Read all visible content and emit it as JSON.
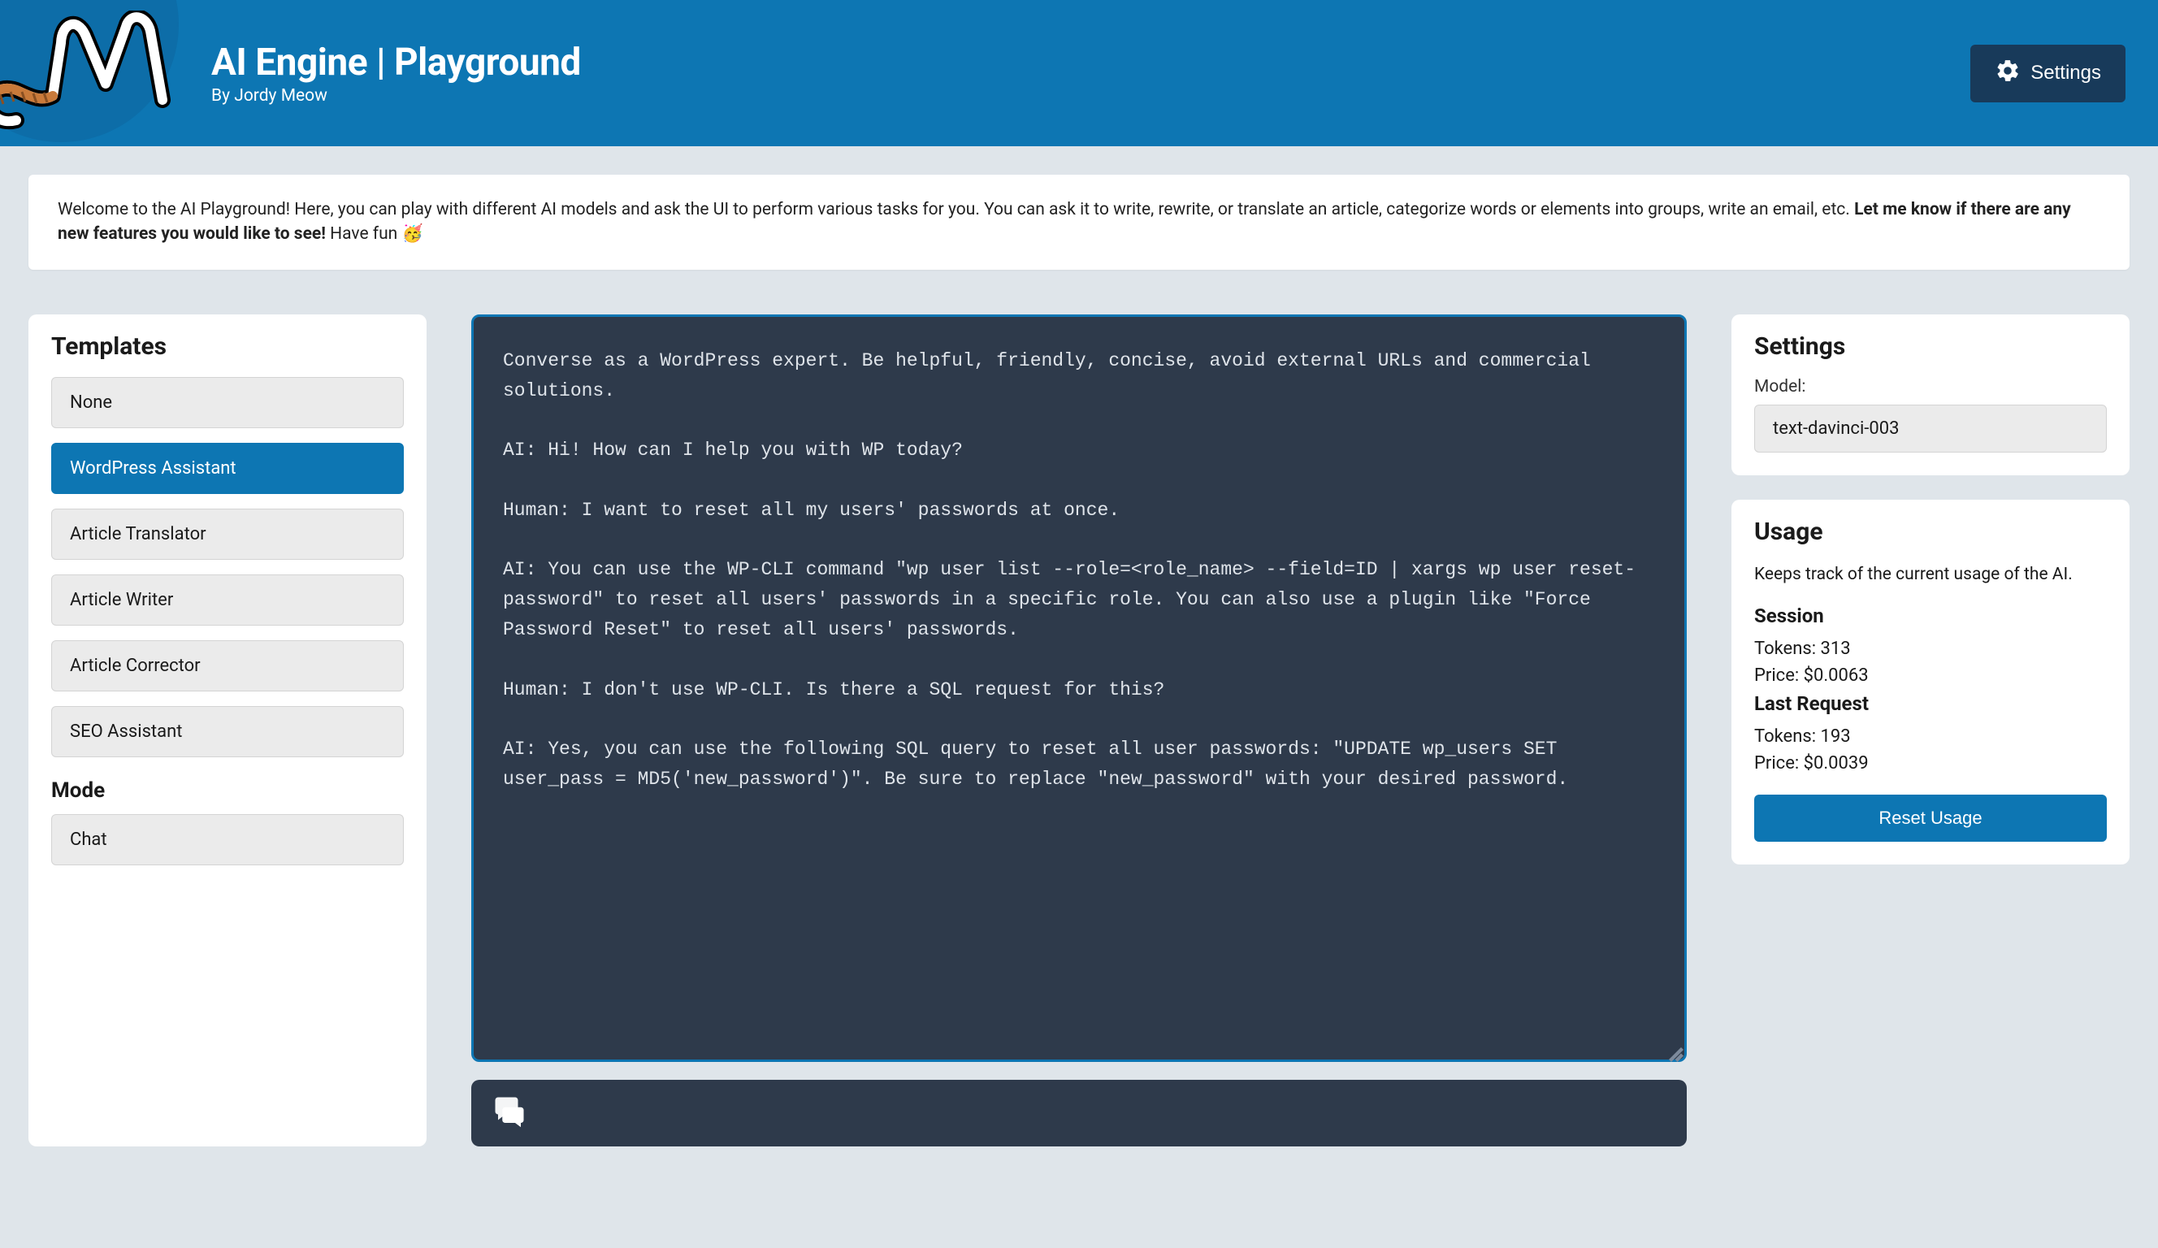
{
  "header": {
    "title": "AI Engine | Playground",
    "byline": "By Jordy Meow",
    "settings_label": "Settings"
  },
  "welcome": {
    "part1": "Welcome to the AI Playground! Here, you can play with different AI models and ask the UI to perform various tasks for you. You can ask it to write, rewrite, or translate an article, categorize words or elements into groups, write an email, etc. ",
    "bold": "Let me know if there are any new features you would like to see!",
    "part2": " Have fun 🥳"
  },
  "templates": {
    "heading": "Templates",
    "items": [
      "None",
      "WordPress Assistant",
      "Article Translator",
      "Article Writer",
      "Article Corrector",
      "SEO Assistant"
    ],
    "selected_index": 1,
    "mode_heading": "Mode",
    "mode_items": [
      "Chat"
    ]
  },
  "editor": {
    "content": "Converse as a WordPress expert. Be helpful, friendly, concise, avoid external URLs and commercial solutions.\n\nAI: Hi! How can I help you with WP today?\n\nHuman: I want to reset all my users' passwords at once.\n\nAI: You can use the WP-CLI command \"wp user list --role=<role_name> --field=ID | xargs wp user reset-password\" to reset all users' passwords in a specific role. You can also use a plugin like \"Force Password Reset\" to reset all users' passwords.\n\nHuman: I don't use WP-CLI. Is there a SQL request for this?\n\nAI: Yes, you can use the following SQL query to reset all user passwords: \"UPDATE wp_users SET user_pass = MD5('new_password')\". Be sure to replace \"new_password\" with your desired password."
  },
  "settings": {
    "heading": "Settings",
    "model_label": "Model:",
    "model_value": "text-davinci-003"
  },
  "usage": {
    "heading": "Usage",
    "description": "Keeps track of the current usage of the AI.",
    "session_heading": "Session",
    "session_tokens_label": "Tokens: ",
    "session_tokens": "313",
    "session_price_label": "Price: ",
    "session_price": "$0.0063",
    "last_heading": "Last Request",
    "last_tokens_label": "Tokens: ",
    "last_tokens": "193",
    "last_price_label": "Price: ",
    "last_price": "$0.0039",
    "reset_label": "Reset Usage"
  }
}
